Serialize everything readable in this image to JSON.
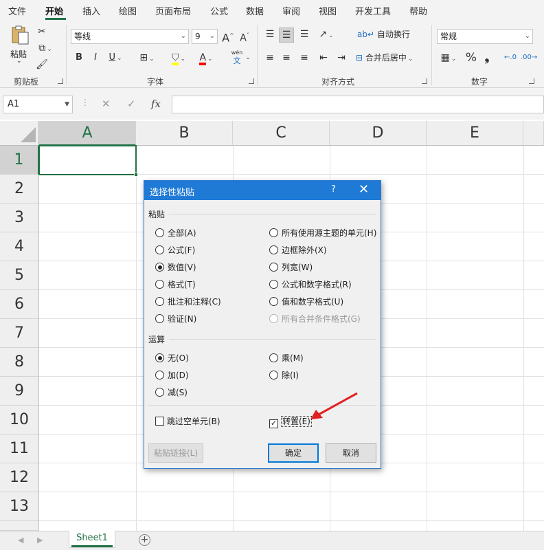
{
  "menu": {
    "items": [
      "文件",
      "开始",
      "插入",
      "绘图",
      "页面布局",
      "公式",
      "数据",
      "审阅",
      "视图",
      "开发工具",
      "帮助"
    ],
    "active": "开始"
  },
  "ribbon": {
    "paste_label": "粘贴",
    "groups": {
      "clipboard": "剪贴板",
      "font": "字体",
      "alignment": "对齐方式",
      "number": "数字"
    },
    "font_name": "等线",
    "font_size": "9",
    "wrap_text": "自动换行",
    "merge_center": "合并后居中",
    "number_format": "常规",
    "grow_font": "A",
    "shrink_font": "A",
    "bold": "B",
    "italic": "I",
    "underline": "U",
    "percent": "%",
    "comma": "❟",
    "phonetic_top": "wén",
    "phonetic_bottom": "文",
    "font_color_letter": "A",
    "colors": {
      "highlight": "#ffff00",
      "font_color": "#ff0000",
      "accent": "#217346"
    }
  },
  "formula_bar": {
    "name_box": "A1",
    "fx": "fx",
    "formula": ""
  },
  "grid": {
    "columns": [
      "A",
      "B",
      "C",
      "D",
      "E"
    ],
    "rows": [
      "1",
      "2",
      "3",
      "4",
      "5",
      "6",
      "7",
      "8",
      "9",
      "10",
      "11",
      "12",
      "13"
    ],
    "selected_cell": "A1"
  },
  "sheets": {
    "tabs": [
      "Sheet1"
    ],
    "add_icon": "+"
  },
  "dialog": {
    "title": "选择性粘贴",
    "help": "?",
    "close": "✕",
    "paste_section": "粘贴",
    "paste_options_left": [
      "全部(A)",
      "公式(F)",
      "数值(V)",
      "格式(T)",
      "批注和注释(C)",
      "验证(N)"
    ],
    "paste_options_right": [
      "所有使用源主题的单元(H)",
      "边框除外(X)",
      "列宽(W)",
      "公式和数字格式(R)",
      "值和数字格式(U)",
      "所有合并条件格式(G)"
    ],
    "paste_selected": "数值(V)",
    "operation_section": "运算",
    "operation_left": [
      "无(O)",
      "加(D)",
      "减(S)"
    ],
    "operation_right": [
      "乘(M)",
      "除(I)"
    ],
    "operation_selected": "无(O)",
    "skip_blanks": "跳过空单元(B)",
    "skip_blanks_checked": false,
    "transpose": "转置(E)",
    "transpose_checked": true,
    "paste_link": "粘贴链接(L)",
    "ok": "确定",
    "cancel": "取消"
  }
}
